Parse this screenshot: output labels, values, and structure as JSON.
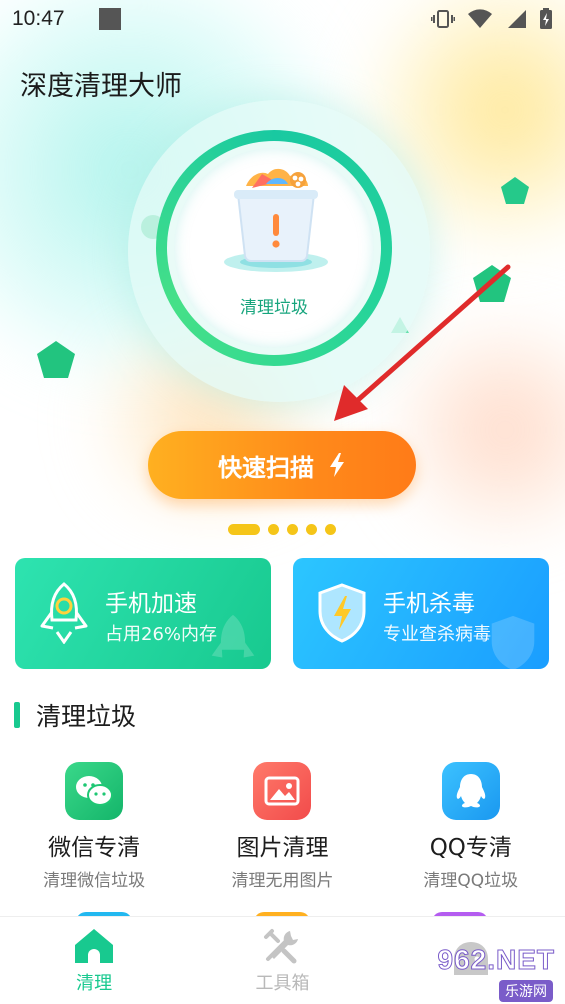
{
  "status_bar": {
    "time": "10:47",
    "icons": [
      "vibrate-icon",
      "wifi-icon",
      "signal-icon",
      "battery-charging-icon"
    ]
  },
  "app": {
    "title": "深度清理大师"
  },
  "hero": {
    "ring_label": "清理垃圾"
  },
  "scan_button": {
    "label": "快速扫描",
    "icon": "lightning-icon"
  },
  "pager": {
    "count": 5,
    "active_index": 0
  },
  "cards": [
    {
      "title": "手机加速",
      "subtitle": "占用26%内存",
      "icon": "rocket-icon"
    },
    {
      "title": "手机杀毒",
      "subtitle": "专业查杀病毒",
      "icon": "shield-icon"
    }
  ],
  "section": {
    "title": "清理垃圾"
  },
  "tools": [
    {
      "name": "微信专清",
      "desc": "清理微信垃圾",
      "icon": "wechat-icon",
      "color": "#1fc774"
    },
    {
      "name": "图片清理",
      "desc": "清理无用图片",
      "icon": "picture-icon",
      "color": "#ff5a5a"
    },
    {
      "name": "QQ专清",
      "desc": "清理QQ垃圾",
      "icon": "qq-icon",
      "color": "#1aa8f5"
    }
  ],
  "bottom_nav": [
    {
      "label": "清理",
      "icon": "home-icon",
      "active": true
    },
    {
      "label": "工具箱",
      "icon": "tools-icon",
      "active": false
    },
    {
      "label": "",
      "icon": "profile-icon",
      "active": false
    }
  ],
  "watermark": {
    "text": "962.NET",
    "sub": "乐游网"
  },
  "colors": {
    "accent": "#18c98f",
    "button": "#ff8a1a",
    "dots": "#f5c518"
  }
}
